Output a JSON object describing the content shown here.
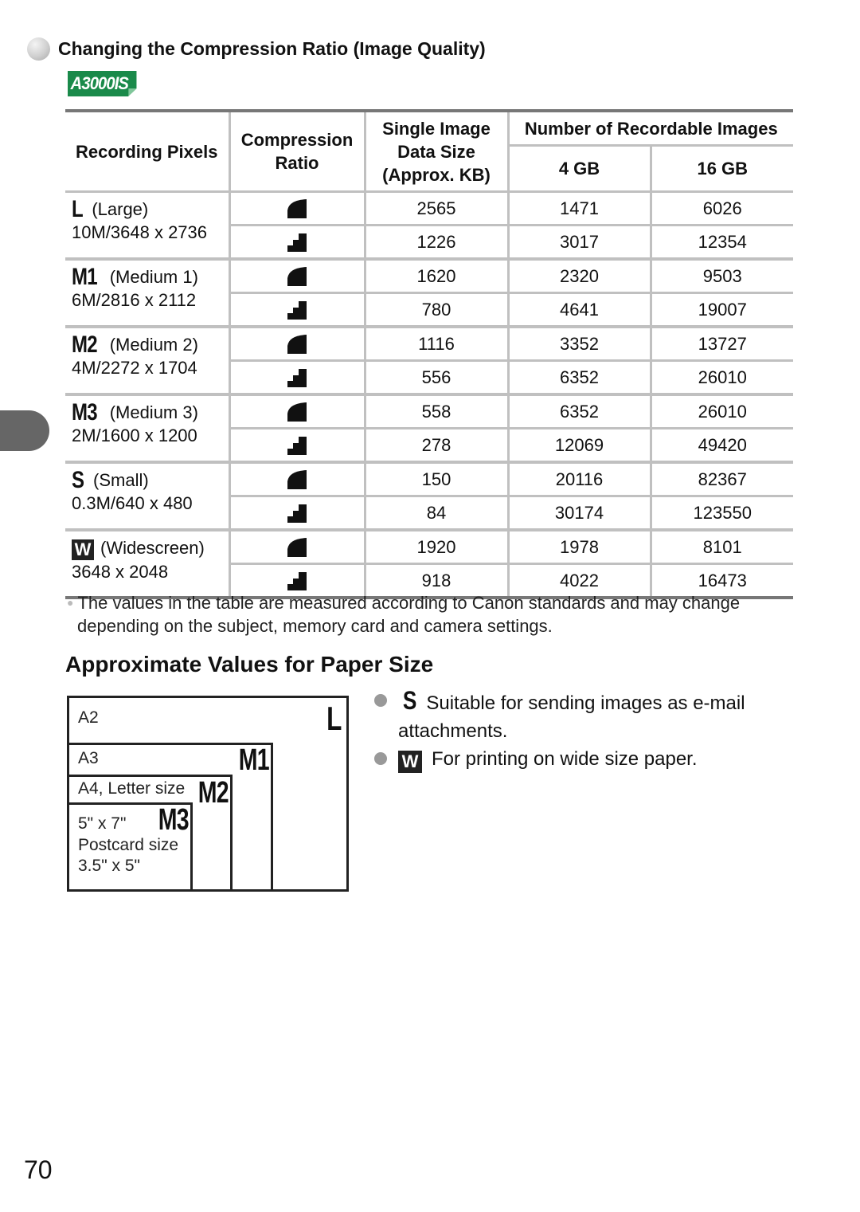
{
  "section": {
    "title": "Changing the Compression Ratio (Image Quality)",
    "model_badge": "A3000IS",
    "badge_color": "#1a8a4a"
  },
  "table": {
    "headers": {
      "recording_pixels": "Recording Pixels",
      "compression_ratio": "Compression Ratio",
      "data_size": "Single Image Data Size (Approx. KB)",
      "recordable": "Number of Recordable Images",
      "gb4": "4 GB",
      "gb16": "16 GB"
    },
    "groups": [
      {
        "mode_icon": "L",
        "mode_name": "(Large)",
        "resolution": "10M/3648 x 2736",
        "rows": [
          {
            "compression": "superfine-icon",
            "size": "2565",
            "gb4": "1471",
            "gb16": "6026"
          },
          {
            "compression": "fine-icon",
            "size": "1226",
            "gb4": "3017",
            "gb16": "12354"
          }
        ]
      },
      {
        "mode_icon": "M1",
        "mode_name": "(Medium 1)",
        "resolution": "6M/2816 x 2112",
        "rows": [
          {
            "compression": "superfine-icon",
            "size": "1620",
            "gb4": "2320",
            "gb16": "9503"
          },
          {
            "compression": "fine-icon",
            "size": "780",
            "gb4": "4641",
            "gb16": "19007"
          }
        ]
      },
      {
        "mode_icon": "M2",
        "mode_name": "(Medium 2)",
        "resolution": "4M/2272 x 1704",
        "rows": [
          {
            "compression": "superfine-icon",
            "size": "1116",
            "gb4": "3352",
            "gb16": "13727"
          },
          {
            "compression": "fine-icon",
            "size": "556",
            "gb4": "6352",
            "gb16": "26010"
          }
        ]
      },
      {
        "mode_icon": "M3",
        "mode_name": "(Medium 3)",
        "resolution": "2M/1600 x 1200",
        "rows": [
          {
            "compression": "superfine-icon",
            "size": "558",
            "gb4": "6352",
            "gb16": "26010"
          },
          {
            "compression": "fine-icon",
            "size": "278",
            "gb4": "12069",
            "gb16": "49420"
          }
        ]
      },
      {
        "mode_icon": "S",
        "mode_name": "(Small)",
        "resolution": "0.3M/640 x 480",
        "rows": [
          {
            "compression": "superfine-icon",
            "size": "150",
            "gb4": "20116",
            "gb16": "82367"
          },
          {
            "compression": "fine-icon",
            "size": "84",
            "gb4": "30174",
            "gb16": "123550"
          }
        ]
      },
      {
        "mode_icon": "W",
        "mode_name": "(Widescreen)",
        "resolution": "3648 x 2048",
        "rows": [
          {
            "compression": "superfine-icon",
            "size": "1920",
            "gb4": "1978",
            "gb16": "8101"
          },
          {
            "compression": "fine-icon",
            "size": "918",
            "gb4": "4022",
            "gb16": "16473"
          }
        ]
      }
    ]
  },
  "note": {
    "line1": "The values in the table are measured according to Canon standards and may change",
    "line2": "depending on the subject, memory card and camera settings."
  },
  "paper": {
    "heading": "Approximate Values for Paper Size",
    "diagram": {
      "a2": "A2",
      "l": "L",
      "a3": "A3",
      "m1": "M1",
      "a4": "A4, Letter size",
      "m2": "M2",
      "five_seven": "5\" x 7\"",
      "m3": "M3",
      "postcard": "Postcard size",
      "three_five": "3.5\" x 5\""
    },
    "bullets": [
      {
        "icon": "S",
        "text": "Suitable for sending images as e-mail",
        "cont": "attachments."
      },
      {
        "icon": "W",
        "text": "For printing on wide size paper."
      }
    ]
  },
  "page_number": "70"
}
